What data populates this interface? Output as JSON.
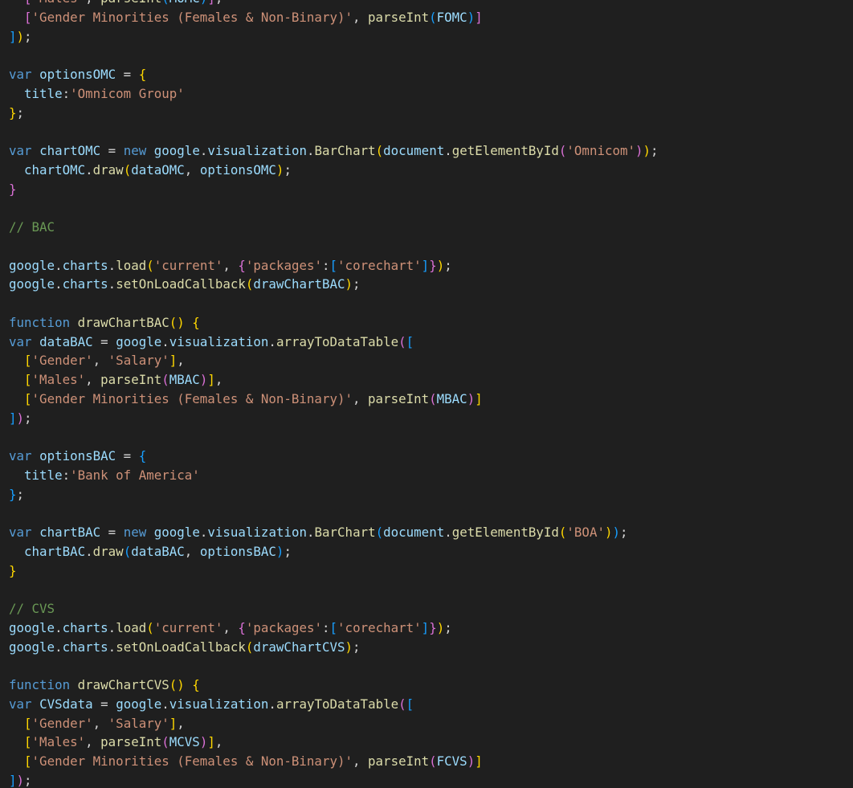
{
  "editor": {
    "theme_colors": {
      "background": "#1f1f1f",
      "keyword": "#569cd6",
      "control_keyword": "#c586c0",
      "variable": "#9cdcfe",
      "function": "#dcdcaa",
      "string": "#ce9178",
      "comment": "#6a9955",
      "text": "#d4d4d4",
      "bracket_gold": "#ffd700",
      "bracket_purple": "#da70d6",
      "bracket_blue": "#179fff"
    },
    "lines": [
      [
        [
          "  ",
          ""
        ],
        [
          "[",
          "bp"
        ],
        [
          "'Males'",
          "str"
        ],
        [
          ", ",
          ""
        ],
        [
          "parseInt",
          "fn"
        ],
        [
          "(",
          "bb"
        ],
        [
          "MOMC",
          "var"
        ],
        [
          ")",
          "bb"
        ],
        [
          "]",
          "bp"
        ],
        [
          ",",
          ""
        ]
      ],
      [
        [
          "  ",
          ""
        ],
        [
          "[",
          "bp"
        ],
        [
          "'Gender Minorities (Females & Non-Binary)'",
          "str"
        ],
        [
          ", ",
          ""
        ],
        [
          "parseInt",
          "fn"
        ],
        [
          "(",
          "bb"
        ],
        [
          "FOMC",
          "var"
        ],
        [
          ")",
          "bb"
        ],
        [
          "]",
          "bp"
        ]
      ],
      [
        [
          "]",
          "bb"
        ],
        [
          ")",
          "bg"
        ],
        [
          ";",
          ""
        ]
      ],
      [],
      [
        [
          "var",
          "kw"
        ],
        [
          " ",
          ""
        ],
        [
          "optionsOMC",
          "var"
        ],
        [
          " = ",
          ""
        ],
        [
          "{",
          "bg"
        ]
      ],
      [
        [
          "  ",
          ""
        ],
        [
          "title",
          "var"
        ],
        [
          ":",
          ""
        ],
        [
          "'Omnicom Group'",
          "str"
        ]
      ],
      [
        [
          "}",
          "bg"
        ],
        [
          ";",
          ""
        ]
      ],
      [],
      [
        [
          "var",
          "kw"
        ],
        [
          " ",
          ""
        ],
        [
          "chartOMC",
          "var"
        ],
        [
          " = ",
          ""
        ],
        [
          "new",
          "kw"
        ],
        [
          " ",
          ""
        ],
        [
          "google",
          "var"
        ],
        [
          ".",
          ""
        ],
        [
          "visualization",
          "var"
        ],
        [
          ".",
          ""
        ],
        [
          "BarChart",
          "fn"
        ],
        [
          "(",
          "bg"
        ],
        [
          "document",
          "var"
        ],
        [
          ".",
          ""
        ],
        [
          "getElementById",
          "fn"
        ],
        [
          "(",
          "bp"
        ],
        [
          "'Omnicom'",
          "str"
        ],
        [
          ")",
          "bp"
        ],
        [
          ")",
          "bg"
        ],
        [
          ";",
          ""
        ]
      ],
      [
        [
          "  ",
          ""
        ],
        [
          "chartOMC",
          "var"
        ],
        [
          ".",
          ""
        ],
        [
          "draw",
          "fn"
        ],
        [
          "(",
          "bg"
        ],
        [
          "dataOMC",
          "var"
        ],
        [
          ", ",
          ""
        ],
        [
          "optionsOMC",
          "var"
        ],
        [
          ")",
          "bg"
        ],
        [
          ";",
          ""
        ]
      ],
      [
        [
          "}",
          "bp"
        ]
      ],
      [],
      [
        [
          "// BAC",
          "cm"
        ]
      ],
      [],
      [
        [
          "google",
          "var"
        ],
        [
          ".",
          ""
        ],
        [
          "charts",
          "var"
        ],
        [
          ".",
          ""
        ],
        [
          "load",
          "fn"
        ],
        [
          "(",
          "bg"
        ],
        [
          "'current'",
          "str"
        ],
        [
          ", ",
          ""
        ],
        [
          "{",
          "bp"
        ],
        [
          "'packages'",
          "str"
        ],
        [
          ":",
          ""
        ],
        [
          "[",
          "bb"
        ],
        [
          "'corechart'",
          "str"
        ],
        [
          "]",
          "bb"
        ],
        [
          "}",
          "bp"
        ],
        [
          ")",
          "bg"
        ],
        [
          ";",
          ""
        ]
      ],
      [
        [
          "google",
          "var"
        ],
        [
          ".",
          ""
        ],
        [
          "charts",
          "var"
        ],
        [
          ".",
          ""
        ],
        [
          "setOnLoadCallback",
          "fn"
        ],
        [
          "(",
          "bg"
        ],
        [
          "drawChartBAC",
          "var"
        ],
        [
          ")",
          "bg"
        ],
        [
          ";",
          ""
        ]
      ],
      [],
      [
        [
          "function",
          "kw"
        ],
        [
          " ",
          ""
        ],
        [
          "drawChartBAC",
          "fn"
        ],
        [
          "()",
          "bg"
        ],
        [
          " ",
          ""
        ],
        [
          "{",
          "bg"
        ]
      ],
      [
        [
          "var",
          "kw"
        ],
        [
          " ",
          ""
        ],
        [
          "dataBAC",
          "var"
        ],
        [
          " = ",
          ""
        ],
        [
          "google",
          "var"
        ],
        [
          ".",
          ""
        ],
        [
          "visualization",
          "var"
        ],
        [
          ".",
          ""
        ],
        [
          "arrayToDataTable",
          "fn"
        ],
        [
          "(",
          "bp"
        ],
        [
          "[",
          "bb"
        ]
      ],
      [
        [
          "  ",
          ""
        ],
        [
          "[",
          "bg"
        ],
        [
          "'Gender'",
          "str"
        ],
        [
          ", ",
          ""
        ],
        [
          "'Salary'",
          "str"
        ],
        [
          "]",
          "bg"
        ],
        [
          ",",
          ""
        ]
      ],
      [
        [
          "  ",
          ""
        ],
        [
          "[",
          "bg"
        ],
        [
          "'Males'",
          "str"
        ],
        [
          ", ",
          ""
        ],
        [
          "parseInt",
          "fn"
        ],
        [
          "(",
          "bp"
        ],
        [
          "MBAC",
          "var"
        ],
        [
          ")",
          "bp"
        ],
        [
          "]",
          "bg"
        ],
        [
          ",",
          ""
        ]
      ],
      [
        [
          "  ",
          ""
        ],
        [
          "[",
          "bg"
        ],
        [
          "'Gender Minorities (Females & Non-Binary)'",
          "str"
        ],
        [
          ", ",
          ""
        ],
        [
          "parseInt",
          "fn"
        ],
        [
          "(",
          "bp"
        ],
        [
          "MBAC",
          "var"
        ],
        [
          ")",
          "bp"
        ],
        [
          "]",
          "bg"
        ]
      ],
      [
        [
          "]",
          "bb"
        ],
        [
          ")",
          "bp"
        ],
        [
          ";",
          ""
        ]
      ],
      [],
      [
        [
          "var",
          "kw"
        ],
        [
          " ",
          ""
        ],
        [
          "optionsBAC",
          "var"
        ],
        [
          " = ",
          ""
        ],
        [
          "{",
          "bb"
        ]
      ],
      [
        [
          "  ",
          ""
        ],
        [
          "title",
          "var"
        ],
        [
          ":",
          ""
        ],
        [
          "'Bank of America'",
          "str"
        ]
      ],
      [
        [
          "}",
          "bb"
        ],
        [
          ";",
          ""
        ]
      ],
      [],
      [
        [
          "var",
          "kw"
        ],
        [
          " ",
          ""
        ],
        [
          "chartBAC",
          "var"
        ],
        [
          " = ",
          ""
        ],
        [
          "new",
          "kw"
        ],
        [
          " ",
          ""
        ],
        [
          "google",
          "var"
        ],
        [
          ".",
          ""
        ],
        [
          "visualization",
          "var"
        ],
        [
          ".",
          ""
        ],
        [
          "BarChart",
          "fn"
        ],
        [
          "(",
          "bb"
        ],
        [
          "document",
          "var"
        ],
        [
          ".",
          ""
        ],
        [
          "getElementById",
          "fn"
        ],
        [
          "(",
          "bg"
        ],
        [
          "'BOA'",
          "str"
        ],
        [
          ")",
          "bg"
        ],
        [
          ")",
          "bb"
        ],
        [
          ";",
          ""
        ]
      ],
      [
        [
          "  ",
          ""
        ],
        [
          "chartBAC",
          "var"
        ],
        [
          ".",
          ""
        ],
        [
          "draw",
          "fn"
        ],
        [
          "(",
          "bb"
        ],
        [
          "dataBAC",
          "var"
        ],
        [
          ", ",
          ""
        ],
        [
          "optionsBAC",
          "var"
        ],
        [
          ")",
          "bb"
        ],
        [
          ";",
          ""
        ]
      ],
      [
        [
          "}",
          "bg"
        ]
      ],
      [],
      [
        [
          "// CVS",
          "cm"
        ]
      ],
      [
        [
          "google",
          "var"
        ],
        [
          ".",
          ""
        ],
        [
          "charts",
          "var"
        ],
        [
          ".",
          ""
        ],
        [
          "load",
          "fn"
        ],
        [
          "(",
          "bg"
        ],
        [
          "'current'",
          "str"
        ],
        [
          ", ",
          ""
        ],
        [
          "{",
          "bp"
        ],
        [
          "'packages'",
          "str"
        ],
        [
          ":",
          ""
        ],
        [
          "[",
          "bb"
        ],
        [
          "'corechart'",
          "str"
        ],
        [
          "]",
          "bb"
        ],
        [
          "}",
          "bp"
        ],
        [
          ")",
          "bg"
        ],
        [
          ";",
          ""
        ]
      ],
      [
        [
          "google",
          "var"
        ],
        [
          ".",
          ""
        ],
        [
          "charts",
          "var"
        ],
        [
          ".",
          ""
        ],
        [
          "setOnLoadCallback",
          "fn"
        ],
        [
          "(",
          "bg"
        ],
        [
          "drawChartCVS",
          "var"
        ],
        [
          ")",
          "bg"
        ],
        [
          ";",
          ""
        ]
      ],
      [],
      [
        [
          "function",
          "kw"
        ],
        [
          " ",
          ""
        ],
        [
          "drawChartCVS",
          "fn"
        ],
        [
          "()",
          "bg"
        ],
        [
          " ",
          ""
        ],
        [
          "{",
          "bg"
        ]
      ],
      [
        [
          "var",
          "kw"
        ],
        [
          " ",
          ""
        ],
        [
          "CVSdata",
          "var"
        ],
        [
          " = ",
          ""
        ],
        [
          "google",
          "var"
        ],
        [
          ".",
          ""
        ],
        [
          "visualization",
          "var"
        ],
        [
          ".",
          ""
        ],
        [
          "arrayToDataTable",
          "fn"
        ],
        [
          "(",
          "bp"
        ],
        [
          "[",
          "bb"
        ]
      ],
      [
        [
          "  ",
          ""
        ],
        [
          "[",
          "bg"
        ],
        [
          "'Gender'",
          "str"
        ],
        [
          ", ",
          ""
        ],
        [
          "'Salary'",
          "str"
        ],
        [
          "]",
          "bg"
        ],
        [
          ",",
          ""
        ]
      ],
      [
        [
          "  ",
          ""
        ],
        [
          "[",
          "bg"
        ],
        [
          "'Males'",
          "str"
        ],
        [
          ", ",
          ""
        ],
        [
          "parseInt",
          "fn"
        ],
        [
          "(",
          "bp"
        ],
        [
          "MCVS",
          "var"
        ],
        [
          ")",
          "bp"
        ],
        [
          "]",
          "bg"
        ],
        [
          ",",
          ""
        ]
      ],
      [
        [
          "  ",
          ""
        ],
        [
          "[",
          "bg"
        ],
        [
          "'Gender Minorities (Females & Non-Binary)'",
          "str"
        ],
        [
          ", ",
          ""
        ],
        [
          "parseInt",
          "fn"
        ],
        [
          "(",
          "bp"
        ],
        [
          "FCVS",
          "var"
        ],
        [
          ")",
          "bp"
        ],
        [
          "]",
          "bg"
        ]
      ],
      [
        [
          "]",
          "bb"
        ],
        [
          ")",
          "bp"
        ],
        [
          ";",
          ""
        ]
      ]
    ]
  }
}
